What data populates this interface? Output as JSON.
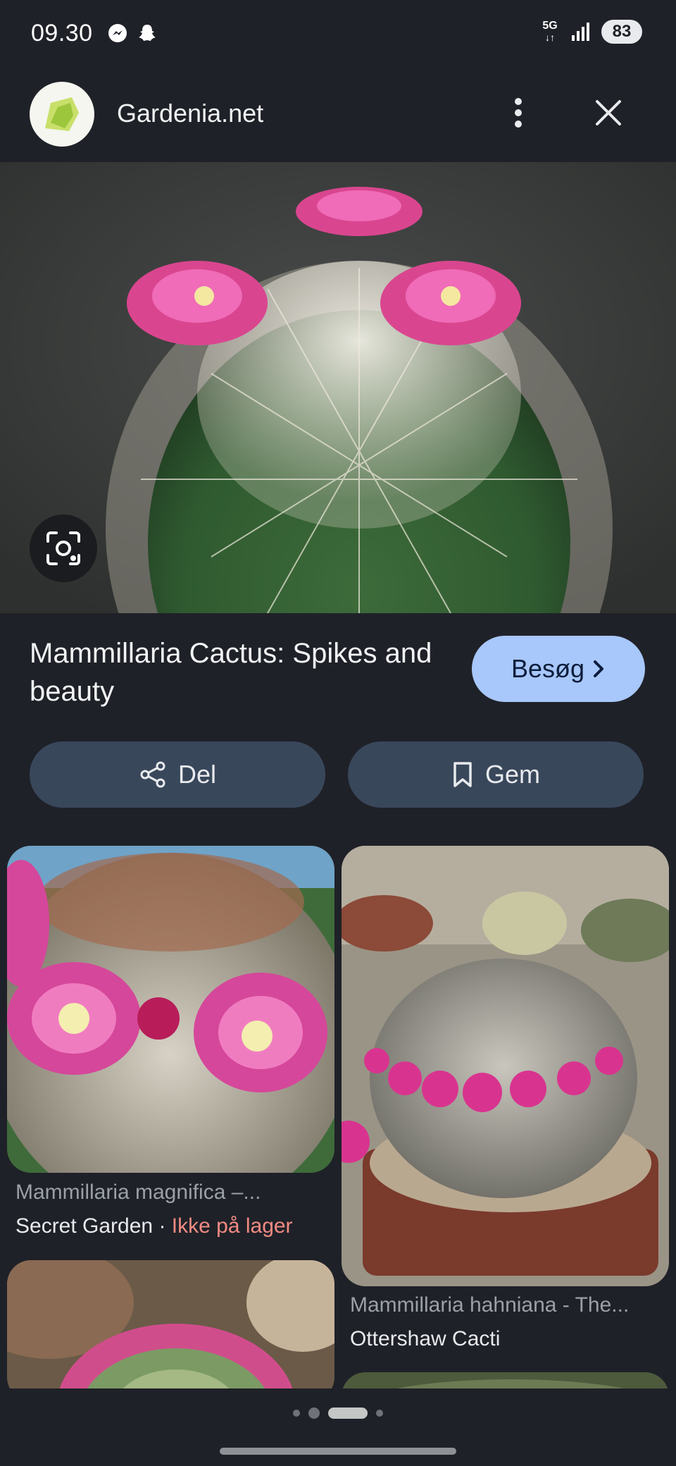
{
  "status_bar": {
    "time": "09.30",
    "network": "5G",
    "battery": "83",
    "icons": [
      "messenger-icon",
      "snapchat-icon",
      "signal-icon"
    ]
  },
  "header": {
    "site_name": "Gardenia.net",
    "icons": [
      "site-logo-icon",
      "more-vert-icon",
      "close-icon"
    ]
  },
  "hero": {
    "icons": [
      "google-lens-icon"
    ]
  },
  "result": {
    "title": "Mammillaria Cactus: Spikes and beauty",
    "visit_label": "Besøg"
  },
  "actions": {
    "share_label": "Del",
    "save_label": "Gem"
  },
  "related": [
    {
      "title": "Mammillaria magnifica –...",
      "source": "Secret Garden",
      "separator": " · ",
      "stock": "Ikke på lager"
    },
    {
      "title": "Mammillaria hahniana - The...",
      "source": "Ottershaw Cacti"
    }
  ],
  "pager": {
    "active_index": 2,
    "count": 4
  },
  "colors": {
    "background": "#1f2128",
    "visit_button": "#a8c7fa",
    "action_button": "#39475b",
    "stock_warning": "#f28b82"
  }
}
